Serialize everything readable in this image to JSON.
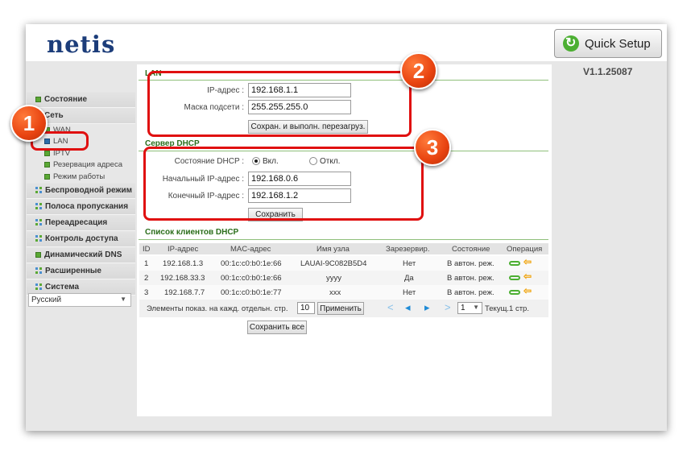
{
  "header": {
    "logo": "netis",
    "quick_setup": "Quick Setup",
    "version": "V1.1.25087"
  },
  "sidebar": {
    "items": [
      {
        "label": "Состояние",
        "icon": "green-square-icon"
      },
      {
        "label": "Сеть",
        "icon": "green-square-icon"
      },
      {
        "label": "Беспроводной режим",
        "icon": "grid-icon"
      },
      {
        "label": "Полоса пропускания",
        "icon": "grid-icon"
      },
      {
        "label": "Переадресация",
        "icon": "grid-icon"
      },
      {
        "label": "Контроль доступа",
        "icon": "grid-icon"
      },
      {
        "label": "Динамический DNS",
        "icon": "green-square-icon"
      },
      {
        "label": "Расширенные",
        "icon": "grid-icon"
      },
      {
        "label": "Система",
        "icon": "grid-icon"
      }
    ],
    "subitems": [
      {
        "label": "WAN"
      },
      {
        "label": "LAN"
      },
      {
        "label": "IPTV"
      },
      {
        "label": "Резервация адреса"
      },
      {
        "label": "Режим работы"
      }
    ],
    "language": "Русский"
  },
  "lan": {
    "title": "LAN",
    "ip_label": "IP-адрес :",
    "ip_value": "192.168.1.1",
    "mask_label": "Маска подсети :",
    "mask_value": "255.255.255.0",
    "save_button": "Сохран. и выполн. перезагруз."
  },
  "dhcp": {
    "title": "Сервер DHCP",
    "state_label": "Состояние DHCP :",
    "on_label": "Вкл.",
    "off_label": "Откл.",
    "selected": "Вкл.",
    "start_label": "Начальный IP-адрес :",
    "start_value": "192.168.0.6",
    "end_label": "Конечный IP-адрес :",
    "end_value": "192.168.1.2",
    "save_button": "Сохранить"
  },
  "clients": {
    "title": "Список клиентов DHCP",
    "columns": [
      "ID",
      "IP-адрес",
      "MAC-адрес",
      "Имя узла",
      "Зарезервир.",
      "Состояние",
      "Операция"
    ],
    "rows": [
      [
        "1",
        "192.168.1.3",
        "00:1c:c0:b0:1e:66",
        "LAUAI-9C082B5D4",
        "Нет",
        "В автон. реж."
      ],
      [
        "2",
        "192.168.33.3",
        "00:1c:c0:b0:1e:66",
        "yyyy",
        "Да",
        "В автон. реж."
      ],
      [
        "3",
        "192.168.7.7",
        "00:1c:c0:b0:1e:77",
        "xxx",
        "Нет",
        "В автон. реж."
      ]
    ],
    "per_page_label": "Элементы показ. на кажд. отдельн. стр.",
    "per_page_value": "10",
    "apply_button": "Применить",
    "page_value": "1",
    "current_page": "Текущ.1 стр.",
    "save_all_button": "Сохранить все"
  },
  "annotations": {
    "badge1": "1",
    "badge2": "2",
    "badge3": "3",
    "color": "#e01010"
  }
}
